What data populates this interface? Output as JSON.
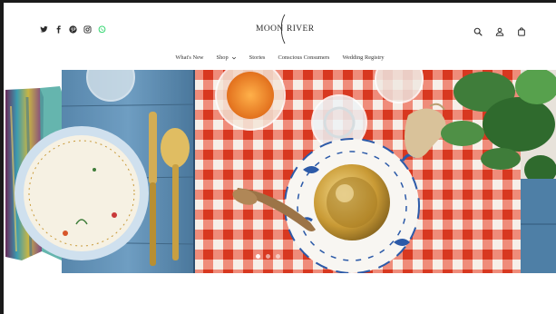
{
  "brand": {
    "left": "MOON",
    "right": "RIVER"
  },
  "social": [
    {
      "name": "twitter-icon"
    },
    {
      "name": "facebook-icon"
    },
    {
      "name": "pinterest-icon"
    },
    {
      "name": "instagram-icon"
    },
    {
      "name": "whatsapp-icon",
      "color": "#25d366"
    }
  ],
  "nav": {
    "items": [
      {
        "label": "What's New"
      },
      {
        "label": "Shop",
        "has_dropdown": true
      },
      {
        "label": "Stories"
      },
      {
        "label": "Conscious Consumers"
      },
      {
        "label": "Wedding Registry"
      }
    ]
  },
  "actions": [
    {
      "name": "search-icon"
    },
    {
      "name": "account-icon"
    },
    {
      "name": "cart-icon"
    }
  ],
  "colors": {
    "gingham_red": "#e8442b",
    "table_blue": "#5a8fb8",
    "plate_blue": "#2c5aa8",
    "gold": "#c9a24a",
    "leaf_green": "#3f7d3a"
  }
}
